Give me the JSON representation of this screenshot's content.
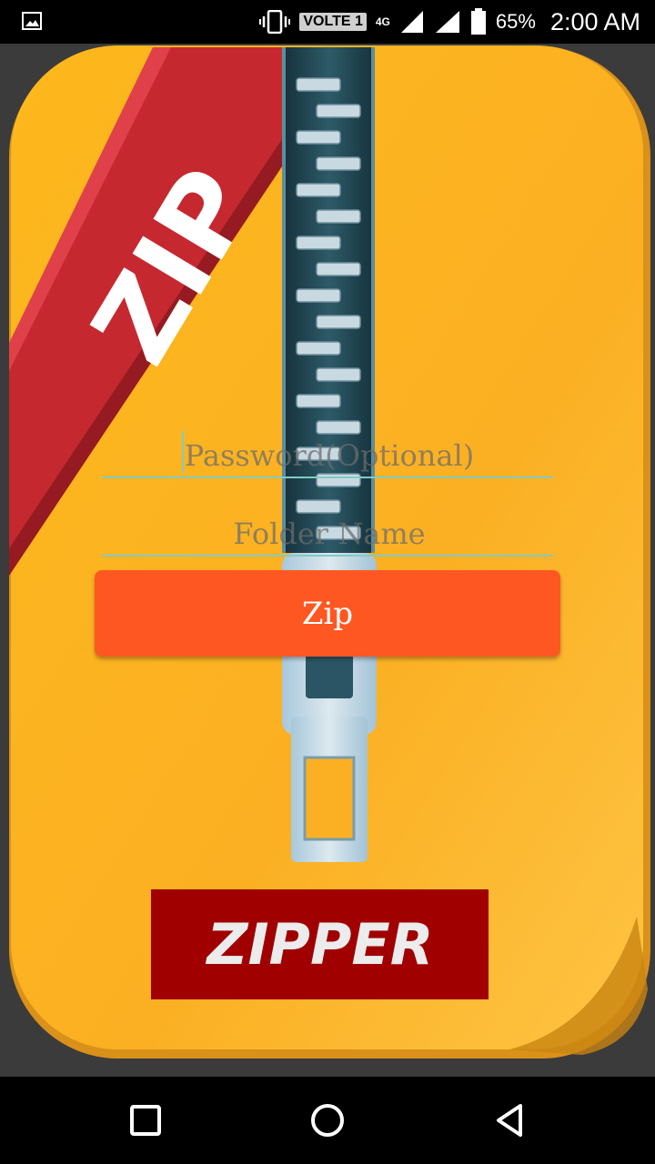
{
  "status_bar": {
    "volte": "VOLTE 1",
    "network": "4G",
    "battery_percent": "65%",
    "time": "2:00 AM",
    "icons": [
      "gallery-icon",
      "vibrate-icon",
      "signal-icon",
      "battery-icon"
    ]
  },
  "artwork": {
    "ribbon_text": "ZIP",
    "banner_text": "ZIPPER",
    "colors": {
      "background": "#fdb92b",
      "ribbon": "#c62830",
      "banner": "#a00000",
      "zipper_track": "#20434f"
    }
  },
  "form": {
    "password_placeholder": "Password(Optional)",
    "password_value": "",
    "folder_placeholder": "Folder Name",
    "folder_value": "",
    "zip_button_label": "Zip",
    "button_color": "#ff5722",
    "underline_color": "#80cbc4"
  },
  "nav_bar": {
    "icons": [
      "recents-icon",
      "home-icon",
      "back-icon"
    ]
  }
}
